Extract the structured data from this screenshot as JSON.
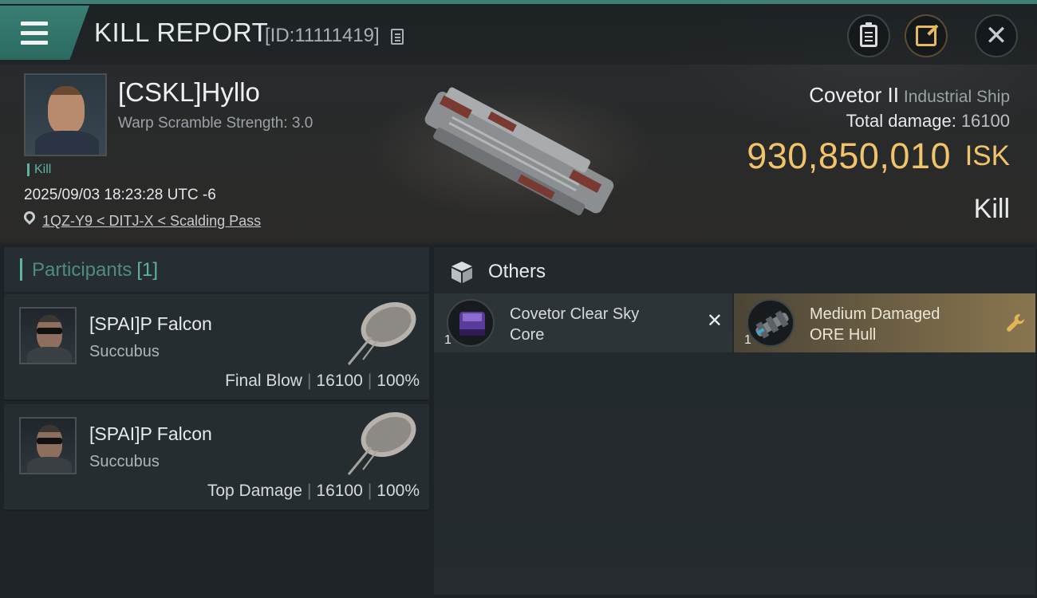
{
  "header": {
    "title": "KILL REPORT",
    "report_id": "[ID:11111419]"
  },
  "victim": {
    "name": "[CSKL]Hyllo",
    "warp_scramble": "Warp Scramble Strength: 3.0",
    "tag": "Kill",
    "datetime": "2025/09/03 18:23:28 UTC -6",
    "location": "1QZ-Y9 < DITJ-X < Scalding Pass",
    "ship_name": "Covetor II",
    "ship_class": "Industrial Ship",
    "total_damage_label": "Total damage:",
    "total_damage": "16100",
    "isk_value": "930,850,010",
    "isk_unit": "ISK",
    "result": "Kill"
  },
  "participants": {
    "title": "Participants",
    "count": "[1]",
    "rows": [
      {
        "name": "[SPAI]P Falcon",
        "ship": "Succubus",
        "role": "Final Blow",
        "damage": "16100",
        "percent": "100%"
      },
      {
        "name": "[SPAI]P Falcon",
        "ship": "Succubus",
        "role": "Top Damage",
        "damage": "16100",
        "percent": "100%"
      }
    ],
    "separator": "|"
  },
  "others": {
    "title": "Others",
    "items": [
      {
        "qty": "1",
        "name": "Covetor Clear Sky Core",
        "status_icon": "destroyed-x-icon"
      },
      {
        "qty": "1",
        "name": "Medium Damaged ORE Hull",
        "status_icon": "wrench-icon"
      }
    ]
  },
  "colors": {
    "accent_teal": "#3f7f75",
    "isk_gold": "#f1c46b",
    "dropped_item_bg": "#8a7650"
  }
}
